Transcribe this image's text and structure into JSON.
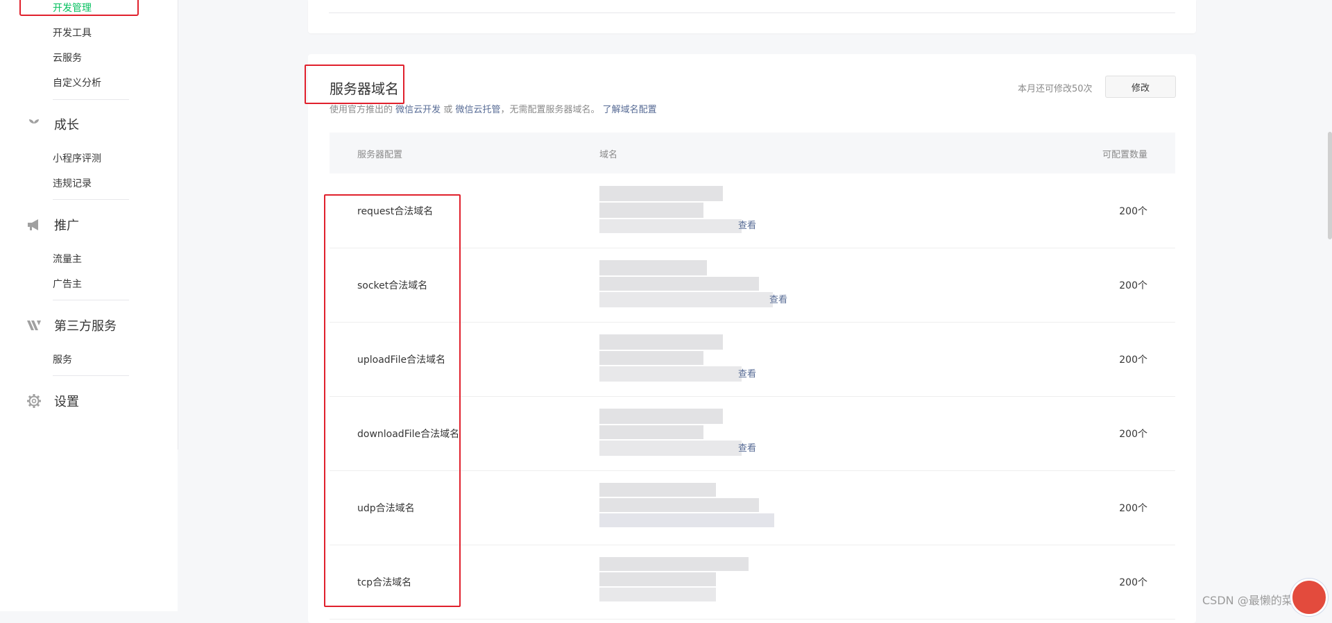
{
  "sidebar": {
    "groups": [
      {
        "id": "dev",
        "sub": [
          "开发管理",
          "开发工具",
          "云服务",
          "自定义分析"
        ]
      },
      {
        "id": "growth",
        "label": "成长",
        "icon": "leaf-icon",
        "sub": [
          "小程序评测",
          "违规记录"
        ]
      },
      {
        "id": "promo",
        "label": "推广",
        "icon": "megaphone-icon",
        "sub": [
          "流量主",
          "广告主"
        ]
      },
      {
        "id": "third",
        "label": "第三方服务",
        "icon": "third-party-icon",
        "sub": [
          "服务"
        ]
      },
      {
        "id": "settings",
        "label": "设置",
        "icon": "gear-icon",
        "sub": []
      }
    ]
  },
  "server_domain": {
    "title": "服务器域名",
    "desc_prefix": "使用官方推出的",
    "link_cloud_dev": "微信云开发",
    "desc_or": "或",
    "link_cloud_host": "微信云托管",
    "desc_suffix": "，无需配置服务器域名。",
    "link_learn": "了解域名配置",
    "quota_text": "本月还可修改50次",
    "modify_label": "修改",
    "table": {
      "headers": [
        "服务器配置",
        "域名",
        "可配置数量"
      ],
      "rows": [
        {
          "config": "request合法域名",
          "count": "200个",
          "view": "查看"
        },
        {
          "config": "socket合法域名",
          "count": "200个",
          "view": "查看"
        },
        {
          "config": "uploadFile合法域名",
          "count": "200个",
          "view": "查看"
        },
        {
          "config": "downloadFile合法域名",
          "count": "200个",
          "view": "查看"
        },
        {
          "config": "udp合法域名",
          "count": "200个",
          "view": ""
        },
        {
          "config": "tcp合法域名",
          "count": "200个",
          "view": ""
        }
      ]
    }
  },
  "watermark": "CSDN @最懒的菜鸟",
  "colors": {
    "accent": "#07c160",
    "link": "#576b95",
    "annotation": "#e0202c"
  }
}
